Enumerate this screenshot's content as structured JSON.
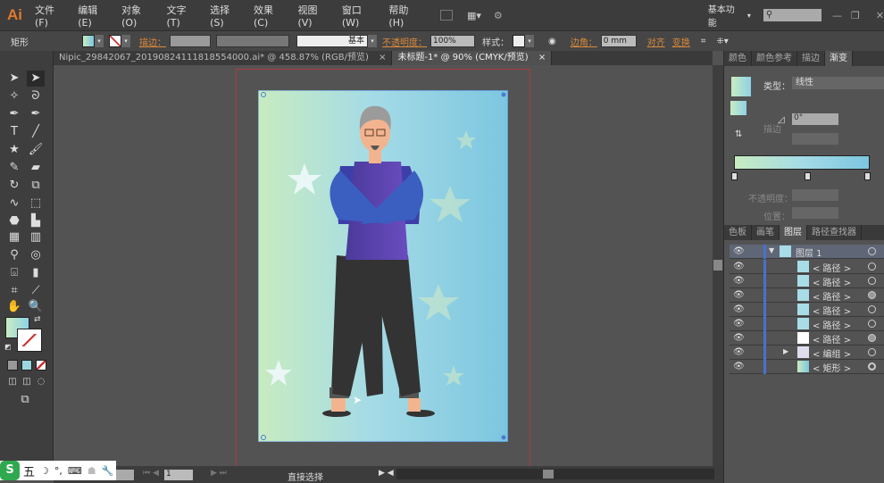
{
  "app": {
    "logo": "Ai",
    "workspace": "基本功能",
    "menus": [
      "文件(F)",
      "编辑(E)",
      "对象(O)",
      "文字(T)",
      "选择(S)",
      "效果(C)",
      "视图(V)",
      "窗口(W)",
      "帮助(H)"
    ]
  },
  "control": {
    "object_type": "矩形",
    "stroke_label": "描边：",
    "stroke_style": "基本",
    "opacity_label": "不透明度：",
    "opacity": "100%",
    "style_label": "样式：",
    "corner_label": "边角：",
    "corner_value": "0 mm",
    "align": "对齐",
    "transform": "变换"
  },
  "doc_tabs": [
    {
      "label": "Nipic_29842067_20190824111818554000.ai* @ 458.87% (RGB/预览)",
      "close": "×"
    },
    {
      "label": "未标题-1* @ 90% (CMYK/预览)",
      "close": "×"
    }
  ],
  "gradient_panel": {
    "tabs": [
      "颜色",
      "颜色参考",
      "描边",
      "渐变"
    ],
    "type_label": "类型：",
    "type": "线性",
    "stroke_label": "描边",
    "angle": "0°",
    "opacity_label": "不透明度：",
    "position_label": "位置：",
    "colors": [
      "#c8ecc0",
      "#a5dbe6",
      "#7cc6e0"
    ]
  },
  "layers_panel": {
    "tabs": [
      "色板",
      "画笔",
      "图层",
      "路径查找器"
    ],
    "layer": "图层 1",
    "items": [
      "< 路径 >",
      "< 路径 >",
      "< 路径 >",
      "< 路径 >",
      "< 路径 >",
      "< 路径 >",
      "< 编组 >",
      "< 矩形 >"
    ]
  },
  "status": {
    "page": "1",
    "tool": "直接选择"
  },
  "ime": {
    "items": [
      "五",
      "☽",
      "°,",
      "⌨",
      "☗",
      "🔧"
    ]
  }
}
